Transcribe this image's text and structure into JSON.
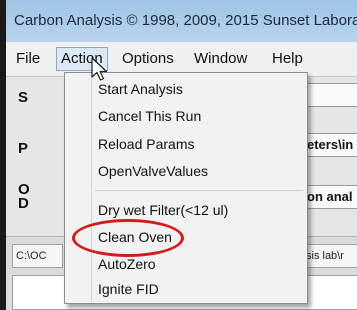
{
  "window": {
    "title": "Carbon Analysis © 1998, 2009, 2015 Sunset Labora"
  },
  "menubar": {
    "items": [
      "File",
      "Action",
      "Options",
      "Window",
      "Help"
    ],
    "active": "Action"
  },
  "main": {
    "side_labels": [
      "S",
      "P",
      "O",
      "D"
    ],
    "field_params": "eters\\in",
    "field_analysis": "on anal",
    "path_left": "C:\\OC",
    "path_right": "sis lab\\r"
  },
  "action_menu": {
    "items": [
      {
        "label": "Start Analysis"
      },
      {
        "label": "Cancel This Run"
      },
      {
        "label": "Reload Params"
      },
      {
        "label": "OpenValveValues"
      },
      {
        "label": "Dry wet Filter(<12 ul)"
      },
      {
        "label": "Clean Oven",
        "highlighted_by_annotation": true
      },
      {
        "label": "AutoZero"
      },
      {
        "label": "Ignite FID"
      }
    ]
  },
  "colors": {
    "annotation": "#d61a1a",
    "titlebar": "#a8cbe9"
  }
}
